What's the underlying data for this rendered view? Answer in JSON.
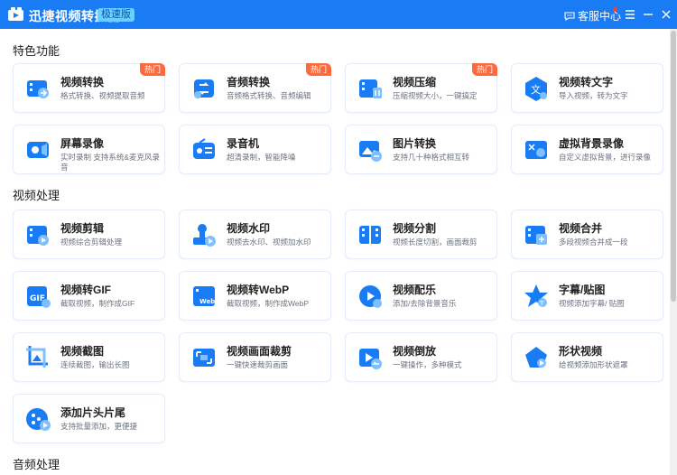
{
  "titlebar": {
    "app_name": "迅捷视频转换器",
    "edition": "极速版",
    "service": "客服中心"
  },
  "sections": [
    {
      "title": "特色功能"
    },
    {
      "title": "视频处理"
    },
    {
      "title": "音频处理"
    }
  ],
  "hot_label": "热门",
  "cards": [
    {
      "title": "视频转换",
      "desc": "格式转换、视频提取音频",
      "hot": true,
      "icon": "video-convert-icon"
    },
    {
      "title": "音频转换",
      "desc": "音频格式转换、音频编辑",
      "hot": true,
      "icon": "audio-convert-icon"
    },
    {
      "title": "视频压缩",
      "desc": "压缩视频大小，一键搞定",
      "hot": true,
      "icon": "video-compress-icon"
    },
    {
      "title": "视频转文字",
      "desc": "导入视频，转为文字",
      "hot": false,
      "icon": "video-to-text-icon"
    },
    {
      "title": "屏幕录像",
      "desc": "实时录制 支持系统&麦克风录音",
      "hot": false,
      "icon": "screen-record-icon"
    },
    {
      "title": "录音机",
      "desc": "超清录制，智能降噪",
      "hot": false,
      "icon": "recorder-icon"
    },
    {
      "title": "图片转换",
      "desc": "支持几十种格式相互转",
      "hot": false,
      "icon": "image-convert-icon"
    },
    {
      "title": "虚拟背景录像",
      "desc": "自定义虚拟背景，进行录像",
      "hot": false,
      "icon": "virtual-bg-icon"
    },
    {
      "title": "视频剪辑",
      "desc": "视频综合剪辑处理",
      "hot": false,
      "icon": "video-edit-icon"
    },
    {
      "title": "视频水印",
      "desc": "视频去水印、视频加水印",
      "hot": false,
      "icon": "watermark-icon"
    },
    {
      "title": "视频分割",
      "desc": "视频长度切割，画面裁剪",
      "hot": false,
      "icon": "video-split-icon"
    },
    {
      "title": "视频合并",
      "desc": "多段视频合并成一段",
      "hot": false,
      "icon": "video-merge-icon"
    },
    {
      "title": "视频转GIF",
      "desc": "截取视频，制作成GIF",
      "hot": false,
      "icon": "gif-icon"
    },
    {
      "title": "视频转WebP",
      "desc": "截取视频，制作成WebP",
      "hot": false,
      "icon": "webp-icon"
    },
    {
      "title": "视频配乐",
      "desc": "添加/去除背景音乐",
      "hot": false,
      "icon": "music-icon"
    },
    {
      "title": "字幕/贴图",
      "desc": "视频添加字幕/ 贴图",
      "hot": false,
      "icon": "subtitle-icon"
    },
    {
      "title": "视频截图",
      "desc": "连续截图，输出长图",
      "hot": false,
      "icon": "screenshot-icon"
    },
    {
      "title": "视频画面裁剪",
      "desc": "一键快速裁剪画面",
      "hot": false,
      "icon": "crop-icon"
    },
    {
      "title": "视频倒放",
      "desc": "一键操作，多种模式",
      "hot": false,
      "icon": "reverse-icon"
    },
    {
      "title": "形状视频",
      "desc": "给视频添加形状遮罩",
      "hot": false,
      "icon": "shape-icon"
    },
    {
      "title": "添加片头片尾",
      "desc": "支持批量添加，更便捷",
      "hot": false,
      "icon": "intro-outro-icon"
    }
  ],
  "colors": {
    "primary": "#1a7cf5",
    "hot": "#ff6a3d"
  }
}
